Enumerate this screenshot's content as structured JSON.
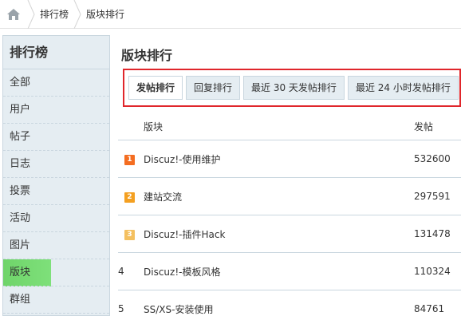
{
  "breadcrumb": {
    "home_icon": "home-icon",
    "items": [
      "排行榜",
      "版块排行"
    ]
  },
  "sidebar": {
    "title": "排行榜",
    "items": [
      {
        "label": "全部"
      },
      {
        "label": "用户"
      },
      {
        "label": "帖子"
      },
      {
        "label": "日志"
      },
      {
        "label": "投票"
      },
      {
        "label": "活动"
      },
      {
        "label": "图片"
      },
      {
        "label": "版块",
        "active": true
      },
      {
        "label": "群组"
      }
    ]
  },
  "main": {
    "title": "版块排行",
    "tabs": [
      {
        "label": "发帖排行",
        "active": true
      },
      {
        "label": "回复排行"
      },
      {
        "label": "最近 30 天发帖排行"
      },
      {
        "label": "最近 24 小时发帖排行"
      }
    ],
    "table": {
      "headers": {
        "name": "版块",
        "count": "发帖"
      },
      "rows": [
        {
          "rank": "1",
          "name": "Discuz!-使用维护",
          "count": "532600",
          "badge_color": "#f46d21"
        },
        {
          "rank": "2",
          "name": "建站交流",
          "count": "297591",
          "badge_color": "#f4a021"
        },
        {
          "rank": "3",
          "name": "Discuz!-插件Hack",
          "count": "131478",
          "badge_color": "#f4c060"
        },
        {
          "rank": "4",
          "name": "Discuz!-模板风格",
          "count": "110324"
        },
        {
          "rank": "5",
          "name": "SS/XS-安装使用",
          "count": "84761"
        }
      ]
    }
  },
  "colors": {
    "highlight_border": "#e0262b",
    "sidebar_bg": "#e5edf2",
    "active_green": "#7ee07a"
  }
}
